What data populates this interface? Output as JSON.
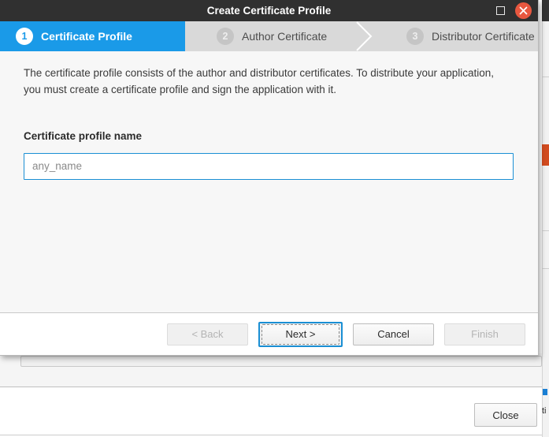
{
  "background_window": {
    "close_button_label": "Close",
    "edge_fragment_text": "ti"
  },
  "dialog": {
    "title": "Create Certificate Profile",
    "window_controls": {
      "maximize_icon": "maximize-icon",
      "close_icon": "close-icon"
    },
    "steps": [
      {
        "number": "1",
        "label": "Certificate Profile",
        "state": "active"
      },
      {
        "number": "2",
        "label": "Author Certificate",
        "state": "inactive"
      },
      {
        "number": "3",
        "label": "Distributor Certificate",
        "state": "inactive"
      }
    ],
    "description": "The certificate profile consists of the author and distributor certificates. To distribute your application, you must create a certificate profile and sign the application with it.",
    "form": {
      "field_label": "Certificate profile name",
      "field_value": "",
      "field_placeholder": "any_name"
    },
    "buttons": {
      "back": "< Back",
      "next": "Next >",
      "cancel": "Cancel",
      "finish": "Finish"
    }
  },
  "colors": {
    "titlebar": "#303030",
    "accent_blue": "#1a9ae8",
    "focus_blue": "#1a8fd4",
    "close_red": "#e8573f",
    "stepbar_grey": "#d9d9d9",
    "body_grey": "#f7f7f7"
  }
}
